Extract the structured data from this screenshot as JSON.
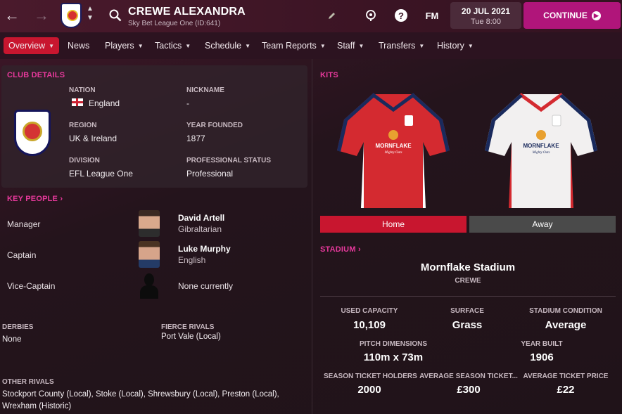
{
  "header": {
    "title": "CREWE ALEXANDRA",
    "subtitle": "Sky Bet League One (ID:641)",
    "date": "20 JUL 2021",
    "time": "Tue 8:00",
    "continue_label": "CONTINUE",
    "fm_label": "FM"
  },
  "nav": [
    {
      "label": "Overview",
      "active": true
    },
    {
      "label": "News"
    },
    {
      "label": "Players"
    },
    {
      "label": "Tactics"
    },
    {
      "label": "Schedule"
    },
    {
      "label": "Team Reports"
    },
    {
      "label": "Staff"
    },
    {
      "label": "Transfers"
    },
    {
      "label": "History"
    }
  ],
  "club_details": {
    "heading": "CLUB DETAILS",
    "nation_label": "NATION",
    "nation": "England",
    "nickname_label": "NICKNAME",
    "nickname": "-",
    "region_label": "REGION",
    "region": "UK & Ireland",
    "founded_label": "YEAR FOUNDED",
    "founded": "1877",
    "division_label": "DIVISION",
    "division": "EFL League One",
    "status_label": "PROFESSIONAL STATUS",
    "status": "Professional",
    "crest_text": "CREWE ALEXANDRA FOOTBALL CLUB"
  },
  "key_people": {
    "heading": "KEY PEOPLE",
    "rows": [
      {
        "role": "Manager",
        "name": "David Artell",
        "nationality": "Gibraltarian"
      },
      {
        "role": "Captain",
        "name": "Luke Murphy",
        "nationality": "English"
      },
      {
        "role": "Vice-Captain",
        "name": "None currently",
        "nationality": ""
      }
    ]
  },
  "rivals": {
    "derbies_label": "DERBIES",
    "derbies": "None",
    "fierce_label": "FIERCE RIVALS",
    "fierce": "Port Vale (Local)",
    "other_label": "OTHER RIVALS",
    "other_line1": "Stockport County (Local), Stoke (Local), Shrewsbury (Local), Preston (Local),",
    "other_line2": "Wrexham (Historic)"
  },
  "kits": {
    "heading": "KITS",
    "home_label": "Home",
    "away_label": "Away",
    "sponsor": "MORNFLAKE",
    "sponsor_sub": "Mighty Oats",
    "home_color": "#d42a30",
    "away_color": "#f2f0f0",
    "trim_color": "#1a2a5c",
    "active_color": "#c8162f"
  },
  "stadium": {
    "heading": "STADIUM",
    "name": "Mornflake Stadium",
    "city": "CREWE",
    "used_capacity_label": "USED CAPACITY",
    "used_capacity": "10,109",
    "surface_label": "SURFACE",
    "surface": "Grass",
    "condition_label": "STADIUM CONDITION",
    "condition": "Average",
    "pitch_label": "PITCH DIMENSIONS",
    "pitch": "110m x 73m",
    "built_label": "YEAR BUILT",
    "built": "1906",
    "season_holders_label": "SEASON TICKET HOLDERS",
    "season_holders": "2000",
    "avg_season_label": "AVERAGE SEASON TICKET...",
    "avg_season": "£300",
    "avg_ticket_label": "AVERAGE TICKET PRICE",
    "avg_ticket": "£22"
  }
}
